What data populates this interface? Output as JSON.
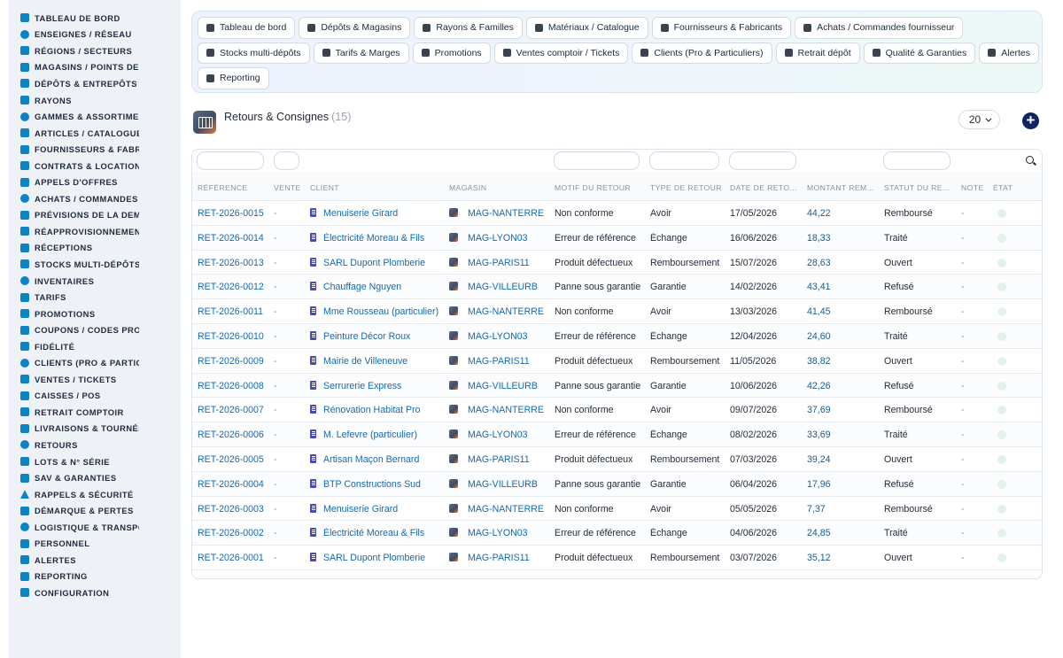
{
  "sidebar": {
    "items": [
      {
        "label": "TABLEAU DE BORD",
        "icon": "dashboard-icon"
      },
      {
        "label": "ENSEIGNES / RÉSEAU",
        "icon": "flag-icon"
      },
      {
        "label": "RÉGIONS / SECTEURS",
        "icon": "map-icon"
      },
      {
        "label": "MAGASINS / POINTS DE VENTE",
        "icon": "store-icon"
      },
      {
        "label": "DÉPÔTS & ENTREPÔTS",
        "icon": "warehouse-icon"
      },
      {
        "label": "RAYONS",
        "icon": "shelf-icon"
      },
      {
        "label": "GAMMES & ASSORTIMENTS",
        "icon": "layers-icon"
      },
      {
        "label": "ARTICLES / CATALOGUE",
        "icon": "catalog-icon"
      },
      {
        "label": "FOURNISSEURS & FABRICANTS",
        "icon": "truck-icon"
      },
      {
        "label": "CONTRATS & LOCATION",
        "icon": "contract-icon"
      },
      {
        "label": "APPELS D'OFFRES",
        "icon": "gavel-icon"
      },
      {
        "label": "ACHATS / COMMANDES FOURNISSEUR",
        "icon": "cart-icon"
      },
      {
        "label": "PRÉVISIONS DE LA DEMANDE",
        "icon": "chart-icon"
      },
      {
        "label": "RÉAPPROVISIONNEMENT",
        "icon": "refresh-icon"
      },
      {
        "label": "RÉCEPTIONS",
        "icon": "inbox-icon"
      },
      {
        "label": "STOCKS MULTI-DÉPÔTS",
        "icon": "boxes-icon"
      },
      {
        "label": "INVENTAIRES",
        "icon": "clipboard-icon"
      },
      {
        "label": "TARIFS",
        "icon": "tag-icon"
      },
      {
        "label": "PROMOTIONS",
        "icon": "percent-icon"
      },
      {
        "label": "COUPONS / CODES PROMO",
        "icon": "ticket-icon"
      },
      {
        "label": "FIDÉLITÉ",
        "icon": "badge-icon"
      },
      {
        "label": "CLIENTS (PRO & PARTICULIERS)",
        "icon": "user-icon"
      },
      {
        "label": "VENTES / TICKETS",
        "icon": "receipt-icon"
      },
      {
        "label": "CAISSES / POS",
        "icon": "cash-register-icon"
      },
      {
        "label": "RETRAIT COMPTOIR",
        "icon": "car-icon"
      },
      {
        "label": "LIVRAISONS & TOURNÉES",
        "icon": "delivery-icon"
      },
      {
        "label": "RETOURS",
        "icon": "return-icon"
      },
      {
        "label": "LOTS & N° SÉRIE",
        "icon": "barcode-icon"
      },
      {
        "label": "SAV & GARANTIES",
        "icon": "tools-icon"
      },
      {
        "label": "RAPPELS & SÉCURITÉ",
        "icon": "warning-icon"
      },
      {
        "label": "DÉMARQUE & PERTES",
        "icon": "trash-icon"
      },
      {
        "label": "LOGISTIQUE & TRANSPORT",
        "icon": "route-icon"
      },
      {
        "label": "PERSONNEL",
        "icon": "users-icon"
      },
      {
        "label": "ALERTES",
        "icon": "bell-icon"
      },
      {
        "label": "REPORTING",
        "icon": "pie-chart-icon"
      },
      {
        "label": "CONFIGURATION",
        "icon": "gear-icon"
      }
    ]
  },
  "chips": {
    "rows": [
      [
        {
          "label": "Tableau de bord",
          "icon": "dashboard-icon"
        },
        {
          "label": "Dépôts & Magasins",
          "icon": "warehouse-icon"
        },
        {
          "label": "Rayons & Familles",
          "icon": "basket-icon"
        },
        {
          "label": "Matériaux / Catalogue",
          "icon": "catalog-icon"
        },
        {
          "label": "Fournisseurs & Fabricants",
          "icon": "truck-icon"
        },
        {
          "label": "Achats / Commandes fournisseur",
          "icon": "cart-icon"
        }
      ],
      [
        {
          "label": "Stocks multi-dépôts",
          "icon": "boxes-icon"
        },
        {
          "label": "Tarifs & Marges",
          "icon": "tag-icon"
        },
        {
          "label": "Promotions",
          "icon": "percent-icon"
        },
        {
          "label": "Ventes comptoir / Tickets",
          "icon": "receipt-icon"
        },
        {
          "label": "Clients (Pro & Particuliers)",
          "icon": "user-icon"
        },
        {
          "label": "Retrait dépôt",
          "icon": "car-icon"
        },
        {
          "label": "Qualité & Garanties",
          "icon": "check-badge-icon"
        },
        {
          "label": "Alertes",
          "icon": "bell-icon"
        }
      ],
      [
        {
          "label": "Reporting",
          "icon": "pie-chart-icon"
        }
      ]
    ]
  },
  "header": {
    "title": "Retours & Consignes",
    "count": "(15)",
    "per_page": "20"
  },
  "table": {
    "columns": [
      "RÉFÉRENCE",
      "VENTE",
      "CLIENT",
      "MAGASIN",
      "MOTIF DU RETOUR",
      "TYPE DE RETOUR",
      "DATE DE RETO...",
      "MONTANT REM...",
      "STATUT DU RE...",
      "NOTE",
      "ÉTAT"
    ],
    "rows": [
      {
        "ref": "RET-2026-0015",
        "vente": "-",
        "client": "Menuiserie Girard",
        "magasin": "MAG-NANTERRE",
        "motif": "Non conforme",
        "type": "Avoir",
        "date": "17/05/2026",
        "montant": "44,22",
        "statut": "Remboursé",
        "note": "-"
      },
      {
        "ref": "RET-2026-0014",
        "vente": "-",
        "client": "Électricité Moreau & Fils",
        "magasin": "MAG-LYON03",
        "motif": "Erreur de référence",
        "type": "Échange",
        "date": "16/06/2026",
        "montant": "18,33",
        "statut": "Traité",
        "note": "-"
      },
      {
        "ref": "RET-2026-0013",
        "vente": "-",
        "client": "SARL Dupont Plomberie",
        "magasin": "MAG-PARIS11",
        "motif": "Produit défectueux",
        "type": "Remboursement",
        "date": "15/07/2026",
        "montant": "28,63",
        "statut": "Ouvert",
        "note": "-"
      },
      {
        "ref": "RET-2026-0012",
        "vente": "-",
        "client": "Chauffage Nguyen",
        "magasin": "MAG-VILLEURB",
        "motif": "Panne sous garantie",
        "type": "Garantie",
        "date": "14/02/2026",
        "montant": "43,41",
        "statut": "Refusé",
        "note": "-"
      },
      {
        "ref": "RET-2026-0011",
        "vente": "-",
        "client": "Mme Rousseau (particulier)",
        "magasin": "MAG-NANTERRE",
        "motif": "Non conforme",
        "type": "Avoir",
        "date": "13/03/2026",
        "montant": "41,45",
        "statut": "Remboursé",
        "note": "-"
      },
      {
        "ref": "RET-2026-0010",
        "vente": "-",
        "client": "Peinture Décor Roux",
        "magasin": "MAG-LYON03",
        "motif": "Erreur de référence",
        "type": "Échange",
        "date": "12/04/2026",
        "montant": "24,60",
        "statut": "Traité",
        "note": "-"
      },
      {
        "ref": "RET-2026-0009",
        "vente": "-",
        "client": "Mairie de Villeneuve",
        "magasin": "MAG-PARIS11",
        "motif": "Produit défectueux",
        "type": "Remboursement",
        "date": "11/05/2026",
        "montant": "38,82",
        "statut": "Ouvert",
        "note": "-"
      },
      {
        "ref": "RET-2026-0008",
        "vente": "-",
        "client": "Serrurerie Express",
        "magasin": "MAG-VILLEURB",
        "motif": "Panne sous garantie",
        "type": "Garantie",
        "date": "10/06/2026",
        "montant": "42,26",
        "statut": "Refusé",
        "note": "-"
      },
      {
        "ref": "RET-2026-0007",
        "vente": "-",
        "client": "Rénovation Habitat Pro",
        "magasin": "MAG-NANTERRE",
        "motif": "Non conforme",
        "type": "Avoir",
        "date": "09/07/2026",
        "montant": "37,69",
        "statut": "Remboursé",
        "note": "-"
      },
      {
        "ref": "RET-2026-0006",
        "vente": "-",
        "client": "M. Lefevre (particulier)",
        "magasin": "MAG-LYON03",
        "motif": "Erreur de référence",
        "type": "Échange",
        "date": "08/02/2026",
        "montant": "33,69",
        "statut": "Traité",
        "note": "-"
      },
      {
        "ref": "RET-2026-0005",
        "vente": "-",
        "client": "Artisan Maçon Bernard",
        "magasin": "MAG-PARIS11",
        "motif": "Produit défectueux",
        "type": "Remboursement",
        "date": "07/03/2026",
        "montant": "39,24",
        "statut": "Ouvert",
        "note": "-"
      },
      {
        "ref": "RET-2026-0004",
        "vente": "-",
        "client": "BTP Constructions Sud",
        "magasin": "MAG-VILLEURB",
        "motif": "Panne sous garantie",
        "type": "Garantie",
        "date": "06/04/2026",
        "montant": "17,96",
        "statut": "Refusé",
        "note": "-"
      },
      {
        "ref": "RET-2026-0003",
        "vente": "-",
        "client": "Menuiserie Girard",
        "magasin": "MAG-NANTERRE",
        "motif": "Non conforme",
        "type": "Avoir",
        "date": "05/05/2026",
        "montant": "7,37",
        "statut": "Remboursé",
        "note": "-"
      },
      {
        "ref": "RET-2026-0002",
        "vente": "-",
        "client": "Électricité Moreau & Fils",
        "magasin": "MAG-LYON03",
        "motif": "Erreur de référence",
        "type": "Échange",
        "date": "04/06/2026",
        "montant": "24,85",
        "statut": "Traité",
        "note": "-"
      },
      {
        "ref": "RET-2026-0001",
        "vente": "-",
        "client": "SARL Dupont Plomberie",
        "magasin": "MAG-PARIS11",
        "motif": "Produit défectueux",
        "type": "Remboursement",
        "date": "03/07/2026",
        "montant": "35,12",
        "statut": "Ouvert",
        "note": "-"
      }
    ]
  },
  "colors": {
    "accent_link": "#1668b0",
    "sidebar_icon": "#0b83c5",
    "add_button": "#0f2560"
  }
}
